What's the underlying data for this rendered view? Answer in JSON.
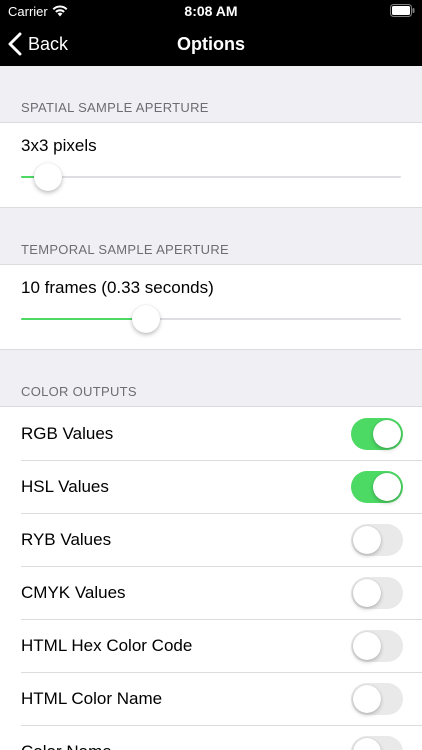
{
  "status_bar": {
    "carrier": "Carrier",
    "time": "8:08 AM",
    "wifi_icon": "wifi-icon",
    "battery_icon": "battery-icon"
  },
  "nav": {
    "back_label": "Back",
    "title": "Options"
  },
  "spatial": {
    "header": "SPATIAL SAMPLE APERTURE",
    "value_label": "3x3 pixels",
    "level": 0.07
  },
  "temporal": {
    "header": "TEMPORAL SAMPLE APERTURE",
    "value_label": "10 frames (0.33 seconds)",
    "level": 0.33
  },
  "color_outputs": {
    "header": "COLOR OUTPUTS",
    "items": [
      {
        "label": "RGB Values",
        "on": true
      },
      {
        "label": "HSL Values",
        "on": true
      },
      {
        "label": "RYB Values",
        "on": false
      },
      {
        "label": "CMYK Values",
        "on": false
      },
      {
        "label": "HTML Hex Color Code",
        "on": false
      },
      {
        "label": "HTML Color Name",
        "on": false
      },
      {
        "label": "Color Name",
        "on": false
      }
    ]
  },
  "colors": {
    "accent": "#4cd964",
    "bar": "#000000",
    "background": "#efeff4"
  }
}
